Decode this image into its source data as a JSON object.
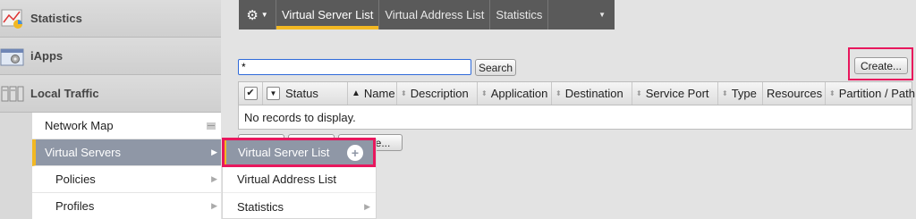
{
  "nav": {
    "categories": [
      {
        "label": "Statistics",
        "icon": "statistics-chart-icon"
      },
      {
        "label": "iApps",
        "icon": "iapps-gear-window-icon"
      },
      {
        "label": "Local Traffic",
        "icon": "local-traffic-servers-icon"
      }
    ],
    "local_traffic_items": [
      {
        "label": "Network Map"
      },
      {
        "label": "Virtual Servers"
      },
      {
        "label": "Policies"
      },
      {
        "label": "Profiles"
      }
    ]
  },
  "flyout": {
    "items": [
      {
        "label": "Virtual Server List"
      },
      {
        "label": "Virtual Address List"
      },
      {
        "label": "Statistics"
      }
    ],
    "plus_glyph": "+"
  },
  "tabs": {
    "items": [
      {
        "label": "Virtual Server List"
      },
      {
        "label": "Virtual Address List"
      },
      {
        "label": "Statistics"
      }
    ]
  },
  "search": {
    "value": "*",
    "button_label": "Search"
  },
  "create_label": "Create...",
  "table": {
    "headers": [
      "Status",
      "Name",
      "Description",
      "Application",
      "Destination",
      "Service Port",
      "Type",
      "Resources",
      "Partition / Path"
    ],
    "empty_message": "No records to display."
  },
  "bottom_buttons": {
    "delete_label": "Delete..."
  },
  "colors": {
    "accent": "#f2b823",
    "highlight": "#e8175d",
    "active_item": "#8f97a6",
    "tabbar": "#5a5a5a"
  }
}
